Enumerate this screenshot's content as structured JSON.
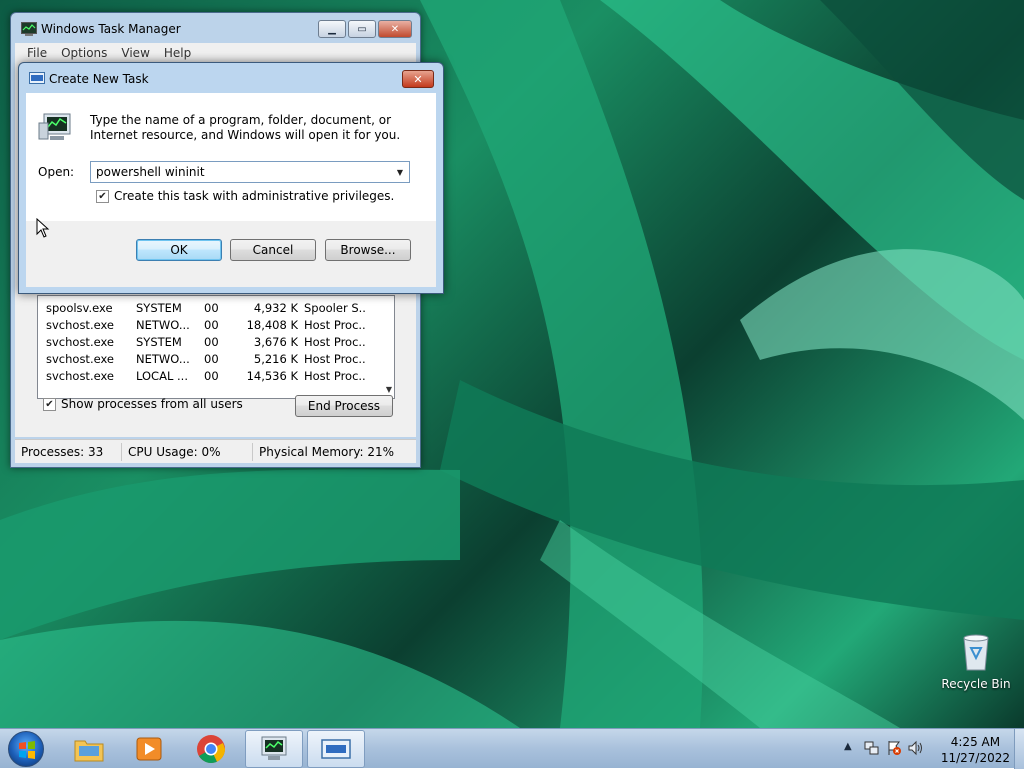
{
  "desktop": {
    "recycle_bin_label": "Recycle Bin"
  },
  "task_manager": {
    "title": "Windows Task Manager",
    "menu": [
      "File",
      "Options",
      "View",
      "Help"
    ],
    "processes": [
      {
        "name": "spoolsv.exe",
        "user": "SYSTEM",
        "cpu": "00",
        "mem": "4,932 K",
        "desc": "Spooler S..."
      },
      {
        "name": "svchost.exe",
        "user": "NETWO...",
        "cpu": "00",
        "mem": "18,408 K",
        "desc": "Host Proc..."
      },
      {
        "name": "svchost.exe",
        "user": "SYSTEM",
        "cpu": "00",
        "mem": "3,676 K",
        "desc": "Host Proc..."
      },
      {
        "name": "svchost.exe",
        "user": "NETWO...",
        "cpu": "00",
        "mem": "5,216 K",
        "desc": "Host Proc..."
      },
      {
        "name": "svchost.exe",
        "user": "LOCAL ...",
        "cpu": "00",
        "mem": "14,536 K",
        "desc": "Host Proc..."
      }
    ],
    "show_all_users_label": "Show processes from all users",
    "show_all_users_checked": true,
    "end_process_label": "End Process",
    "status": {
      "processes": "Processes: 33",
      "cpu": "CPU Usage: 0%",
      "memory": "Physical Memory: 21%"
    }
  },
  "create_task": {
    "title": "Create New Task",
    "description": "Type the name of a program, folder, document, or Internet resource, and Windows will open it for you.",
    "open_label": "Open:",
    "open_value": "powershell wininit",
    "admin_label": "Create this task with administrative privileges.",
    "admin_checked": true,
    "ok_label": "OK",
    "cancel_label": "Cancel",
    "browse_label": "Browse..."
  },
  "taskbar": {
    "pinned": [
      "folder-icon",
      "media-player-icon",
      "chrome-icon",
      "task-manager-icon",
      "run-dialog-icon"
    ],
    "tray_icons": [
      "network-icon",
      "action-center-icon",
      "volume-icon"
    ],
    "time": "4:25 AM",
    "date": "11/27/2022"
  },
  "colors": {
    "taskbar": "#a9c1dc",
    "window_frame": "#bcd6ef",
    "close_button": "#c3391c"
  }
}
